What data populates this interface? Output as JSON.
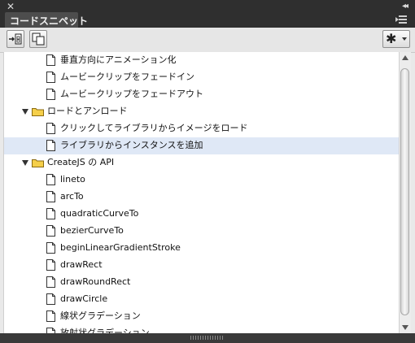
{
  "panel": {
    "close_glyph": "✕",
    "collapse_glyph": "◂◂",
    "tab_label": "コードスニペット"
  },
  "toolbar": {
    "add_to_timeline_icon": "add-to-timeline-icon",
    "copy_to_clipboard_icon": "copy-to-clipboard-icon",
    "options_icon": "gear-icon"
  },
  "colors": {
    "selected_row": "#dfe8f6",
    "folder_fill": "#f5cf4a",
    "dark_chrome": "#2f2f2f"
  },
  "tree": {
    "items": [
      {
        "label": "垂直方向にアニメーション化",
        "type": "snippet",
        "level": 2,
        "selected": false
      },
      {
        "label": "ムービークリップをフェードイン",
        "type": "snippet",
        "level": 2,
        "selected": false
      },
      {
        "label": "ムービークリップをフェードアウト",
        "type": "snippet",
        "level": 2,
        "selected": false
      },
      {
        "label": "ロードとアンロード",
        "type": "folder",
        "level": 1,
        "expanded": true,
        "selected": false
      },
      {
        "label": "クリックしてライブラリからイメージをロード",
        "type": "snippet",
        "level": 2,
        "selected": false
      },
      {
        "label": "ライブラリからインスタンスを追加",
        "type": "snippet",
        "level": 2,
        "selected": true
      },
      {
        "label": "CreateJS の API",
        "type": "folder",
        "level": 1,
        "expanded": true,
        "selected": false
      },
      {
        "label": "lineto",
        "type": "snippet",
        "level": 2,
        "selected": false
      },
      {
        "label": "arcTo",
        "type": "snippet",
        "level": 2,
        "selected": false
      },
      {
        "label": "quadraticCurveTo",
        "type": "snippet",
        "level": 2,
        "selected": false
      },
      {
        "label": "bezierCurveTo",
        "type": "snippet",
        "level": 2,
        "selected": false
      },
      {
        "label": "beginLinearGradientStroke",
        "type": "snippet",
        "level": 2,
        "selected": false
      },
      {
        "label": "drawRect",
        "type": "snippet",
        "level": 2,
        "selected": false
      },
      {
        "label": "drawRoundRect",
        "type": "snippet",
        "level": 2,
        "selected": false
      },
      {
        "label": "drawCircle",
        "type": "snippet",
        "level": 2,
        "selected": false
      },
      {
        "label": "線状グラデーション",
        "type": "snippet",
        "level": 2,
        "selected": false
      },
      {
        "label": "放射状グラデーション",
        "type": "snippet",
        "level": 2,
        "selected": false
      }
    ]
  }
}
